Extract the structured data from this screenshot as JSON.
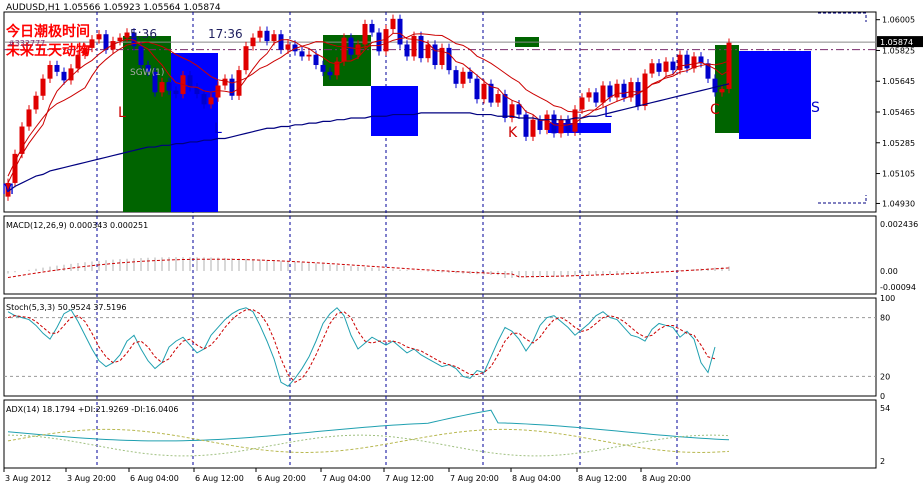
{
  "window": {
    "symbol_header": "AUDUSD,H1  1.05566 1.05923 1.05564 1.05874"
  },
  "colors": {
    "bull": "#e00000",
    "bear": "#0000cc",
    "frame": "#000000",
    "grid_vline": "#000099",
    "price_tag_bg": "#000000",
    "green_box": "#006400",
    "blue_box": "#0000ff"
  },
  "annotations": {
    "overlay_line1": "今日潮极时间",
    "overlay_line2": "未来五天动物",
    "overlay_small": "#332777",
    "time_left": "5:36",
    "time_right": "17:36",
    "letters": [
      "M",
      "L",
      "L",
      "K",
      "L",
      "C",
      "S"
    ],
    "signal": "SGW(1)"
  },
  "chart_data": [
    {
      "type": "candlestick",
      "title": "AUDUSD,H1  1.05566 1.05923 1.05564 1.05874",
      "current_price_tag": "1.05874",
      "ylim": [
        1.0488,
        1.0605
      ],
      "y_ticks": [
        1.06005,
        1.05825,
        1.05645,
        1.05465,
        1.05285,
        1.05105,
        1.0493
      ],
      "y_tick_labels": [
        "1.06005",
        "1.05825",
        "1.05645",
        "1.05465",
        "1.05285",
        "1.05105",
        "1.04930"
      ],
      "x_ticks": [
        "3 Aug 2012",
        "3 Aug 20:00",
        "6 Aug 04:00",
        "6 Aug 12:00",
        "6 Aug 20:00",
        "7 Aug 04:00",
        "7 Aug 12:00",
        "7 Aug 20:00",
        "8 Aug 04:00",
        "8 Aug 12:00",
        "8 Aug 20:00"
      ],
      "close": [
        1.0505,
        1.0522,
        1.0538,
        1.0548,
        1.0556,
        1.0566,
        1.0574,
        1.057,
        1.0565,
        1.0572,
        1.058,
        1.0584,
        1.0589,
        1.0592,
        1.0583,
        1.0588,
        1.059,
        1.0593,
        1.0585,
        1.0574,
        1.057,
        1.0558,
        1.0564,
        1.0559,
        1.0557,
        1.0568,
        1.0561,
        1.0557,
        1.0551,
        1.0555,
        1.0562,
        1.0566,
        1.0556,
        1.0571,
        1.0585,
        1.059,
        1.0594,
        1.0588,
        1.0592,
        1.0583,
        1.0586,
        1.0582,
        1.0579,
        1.058,
        1.0574,
        1.057,
        1.0568,
        1.0576,
        1.059,
        1.058,
        1.0586,
        1.0598,
        1.0593,
        1.0582,
        1.0595,
        1.0601,
        1.0586,
        1.0579,
        1.0591,
        1.0578,
        1.0586,
        1.0574,
        1.0584,
        1.0571,
        1.0563,
        1.057,
        1.0566,
        1.0554,
        1.0563,
        1.0552,
        1.0557,
        1.0543,
        1.0551,
        1.0545,
        1.0532,
        1.0542,
        1.0536,
        1.0545,
        1.0534,
        1.0542,
        1.0535,
        1.0548,
        1.0555,
        1.0558,
        1.0552,
        1.0562,
        1.0555,
        1.0563,
        1.0555,
        1.0564,
        1.055,
        1.0569,
        1.0575,
        1.057,
        1.0576,
        1.0571,
        1.058,
        1.0572,
        1.0579,
        1.0575,
        1.0566,
        1.0558,
        1.056,
        1.0587
      ],
      "ma_slow": [
        1.05,
        1.0503,
        1.0505,
        1.0507,
        1.0509,
        1.051,
        1.0512,
        1.0513,
        1.0514,
        1.0515,
        1.0516,
        1.0517,
        1.0518,
        1.0519,
        1.052,
        1.0521,
        1.0522,
        1.0523,
        1.0524,
        1.0525,
        1.0526,
        1.0526,
        1.0527,
        1.0527,
        1.0528,
        1.0528,
        1.0529,
        1.0529,
        1.053,
        1.053,
        1.0531,
        1.0531,
        1.0532,
        1.0533,
        1.0534,
        1.0535,
        1.0536,
        1.0537,
        1.0537,
        1.0538,
        1.0538,
        1.0539,
        1.0539,
        1.054,
        1.054,
        1.0541,
        1.0541,
        1.0542,
        1.0542,
        1.0543,
        1.0543,
        1.0543,
        1.0544,
        1.0544,
        1.0544,
        1.0545,
        1.0545,
        1.0545,
        1.0545,
        1.0546,
        1.0546,
        1.0546,
        1.0546,
        1.0546,
        1.0546,
        1.0546,
        1.0546,
        1.0545,
        1.0545,
        1.0545,
        1.0544,
        1.0544,
        1.0544,
        1.0543,
        1.0543,
        1.0543,
        1.0542,
        1.0542,
        1.0542,
        1.0542,
        1.0542,
        1.0543,
        1.0543,
        1.0544,
        1.0544,
        1.0545,
        1.0546,
        1.0547,
        1.0548,
        1.0549,
        1.055,
        1.0551,
        1.0552,
        1.0553,
        1.0554,
        1.0555,
        1.0556,
        1.0557,
        1.0558,
        1.0559,
        1.056,
        1.0561,
        1.0562,
        1.0563
      ]
    },
    {
      "type": "macd",
      "label": "MACD(12,26,9) 0.000343 0.000251",
      "y_tick_labels": [
        "0.002436",
        "0.00",
        "-0.00094"
      ]
    },
    {
      "type": "stochastic",
      "label": "Stoch(5,3,3) 50.9524 37.5196",
      "y_tick_labels": [
        "100",
        "80",
        "20",
        "0"
      ],
      "k": [
        86,
        82,
        80,
        78,
        72,
        64,
        58,
        70,
        84,
        88,
        76,
        62,
        48,
        36,
        30,
        34,
        42,
        56,
        62,
        48,
        36,
        28,
        34,
        50,
        56,
        60,
        52,
        44,
        48,
        62,
        70,
        78,
        84,
        88,
        90,
        86,
        72,
        56,
        38,
        14,
        10,
        18,
        28,
        40,
        56,
        74,
        84,
        90,
        82,
        62,
        48,
        54,
        60,
        56,
        52,
        56,
        50,
        44,
        48,
        42,
        38,
        34,
        30,
        32,
        28,
        20,
        18,
        26,
        24,
        40,
        56,
        70,
        66,
        58,
        46,
        56,
        72,
        80,
        82,
        76,
        70,
        62,
        68,
        74,
        82,
        86,
        80,
        78,
        70,
        62,
        60,
        56,
        68,
        74,
        72,
        70,
        60,
        66,
        58,
        34,
        24,
        50
      ],
      "d": [
        80,
        82,
        81,
        80,
        76,
        70,
        64,
        64,
        72,
        80,
        82,
        76,
        64,
        50,
        40,
        34,
        36,
        44,
        54,
        56,
        50,
        40,
        34,
        38,
        48,
        56,
        58,
        52,
        48,
        52,
        60,
        70,
        78,
        84,
        88,
        88,
        84,
        74,
        58,
        38,
        22,
        14,
        18,
        28,
        42,
        58,
        74,
        84,
        86,
        80,
        66,
        56,
        54,
        56,
        56,
        56,
        54,
        50,
        48,
        46,
        42,
        38,
        34,
        32,
        30,
        26,
        22,
        22,
        24,
        30,
        42,
        56,
        64,
        64,
        58,
        54,
        60,
        70,
        78,
        80,
        76,
        70,
        66,
        68,
        74,
        80,
        82,
        80,
        76,
        70,
        64,
        60,
        62,
        68,
        72,
        72,
        68,
        64,
        62,
        52,
        40,
        38
      ]
    },
    {
      "type": "adx",
      "label": "ADX(14) 18.1794 +DI:21.9269 -DI:16.0406",
      "y_tick_labels": [
        "54",
        "2"
      ]
    }
  ]
}
